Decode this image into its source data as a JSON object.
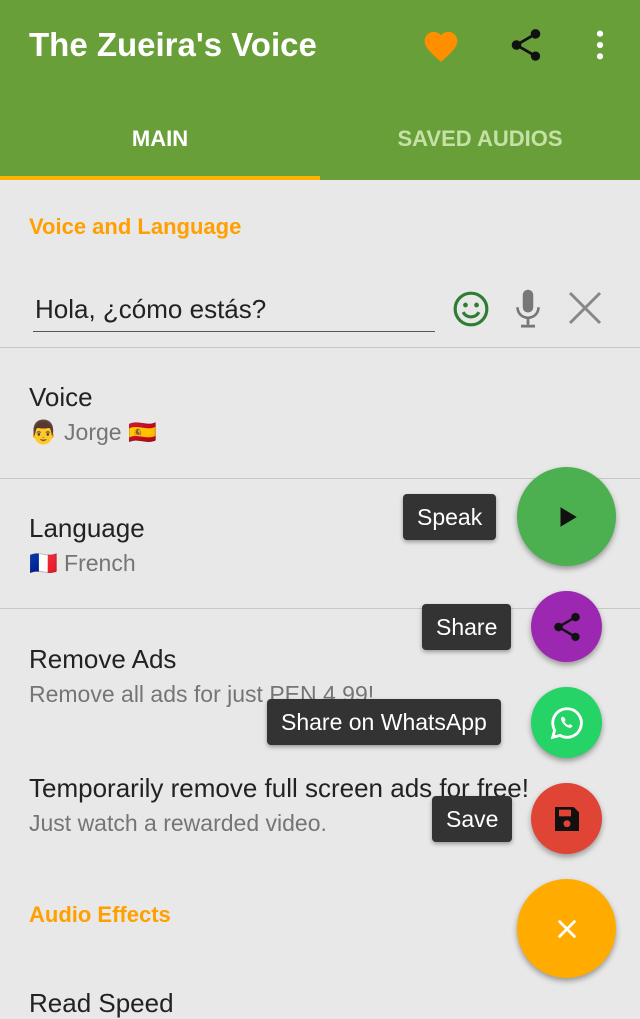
{
  "app_title": "The Zueira's Voice",
  "toolbar": {
    "icons": [
      "heart-icon",
      "share-icon",
      "more-vert-icon"
    ]
  },
  "tabs": [
    {
      "label": "MAIN",
      "active": true
    },
    {
      "label": "SAVED AUDIOS",
      "active": false
    }
  ],
  "sections": {
    "voice_language": "Voice and Language",
    "audio_effects": "Audio Effects"
  },
  "input": {
    "value": "Hola, ¿cómo estás?"
  },
  "items": [
    {
      "title": "Voice",
      "subtitle": "👨 Jorge 🇪🇸"
    },
    {
      "title": "Language",
      "subtitle": "🇫🇷 French"
    },
    {
      "title": "Remove Ads",
      "subtitle": "Remove all ads for just PEN 4.99!"
    },
    {
      "title": "Temporarily remove full screen ads for free!",
      "subtitle": "Just watch a rewarded video."
    },
    {
      "title": "Read Speed"
    }
  ],
  "fab_menu": {
    "speak": "Speak",
    "share": "Share",
    "whatsapp": "Share on WhatsApp",
    "save": "Save"
  },
  "colors": {
    "primary": "#689f38",
    "accent": "#ffb300",
    "speak": "#4caf50",
    "share": "#9c27b0",
    "whatsapp": "#25d366",
    "save": "#e04434",
    "main_fab": "#ffab00"
  }
}
